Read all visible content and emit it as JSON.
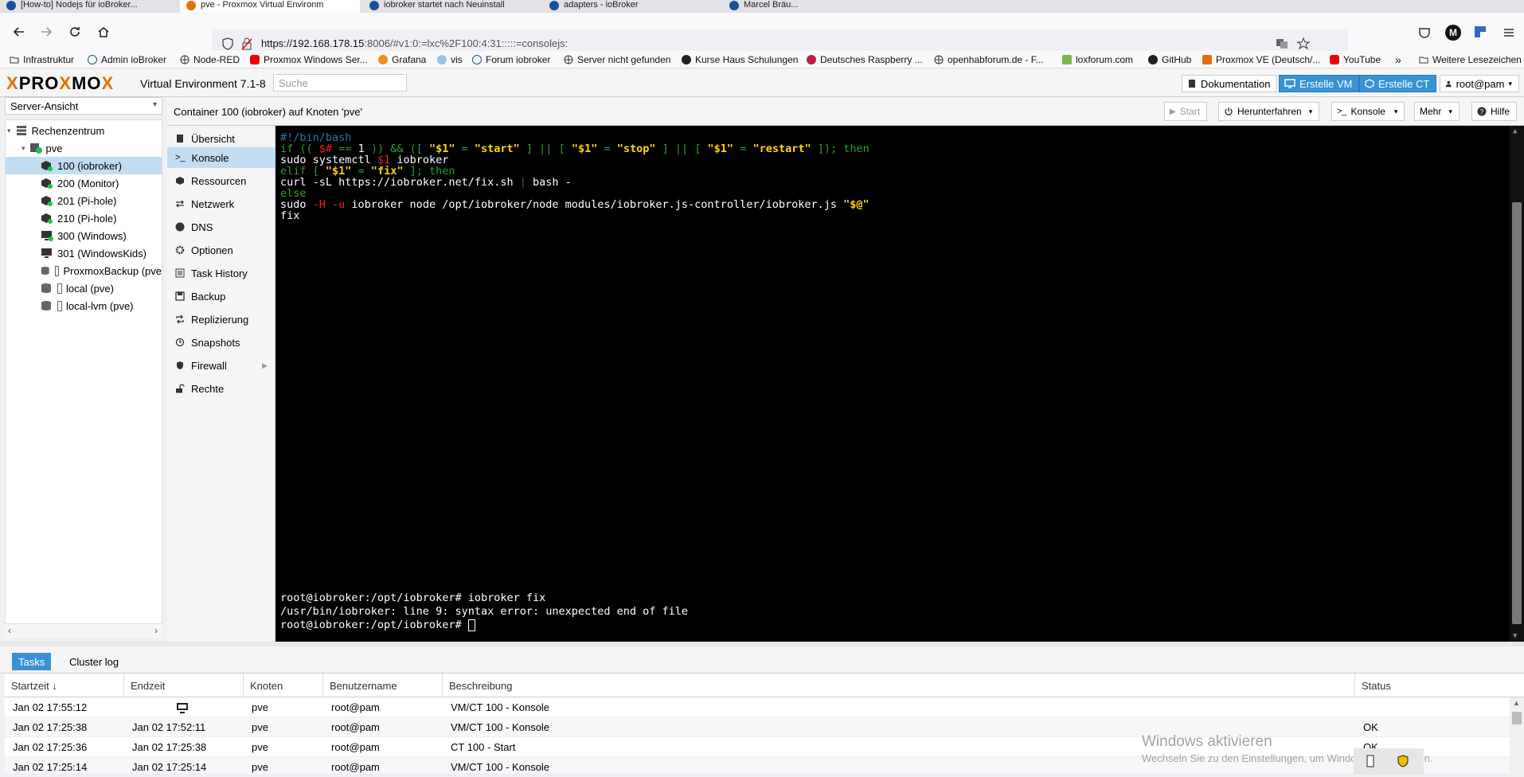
{
  "browser": {
    "tabs": [
      {
        "label": "[How-to] Nodejs für ioBroker...",
        "active": false
      },
      {
        "label": "pve - Proxmox Virtual Environm",
        "active": true
      },
      {
        "label": "iobroker startet nach Neuinstall",
        "active": false
      },
      {
        "label": "adapters - ioBroker",
        "active": false
      },
      {
        "label": "Marcel Bräu...",
        "active": false
      }
    ],
    "url_host": "https://192.168.178.15",
    "url_rest": ":8006/#v1:0:=lxc%2F100:4:31:::::=consolejs:",
    "bookmarks": [
      "Infrastruktur",
      "Admin ioBroker",
      "Node-RED",
      "Proxmox Windows Ser...",
      "Grafana",
      "vis",
      "Forum iobroker",
      "Server nicht gefunden",
      "Kurse Haus Schulungen",
      "Deutsches Raspberry ...",
      "openhabforum.de - F...",
      "loxforum.com",
      "GitHub",
      "Proxmox VE (Deutsch/...",
      "YouTube"
    ],
    "more_bookmarks": "Weitere Lesezeichen"
  },
  "header": {
    "logo_a": "PRO",
    "logo_b": "X",
    "logo_c": "MO",
    "logo_d": "X",
    "version": "Virtual Environment 7.1-8",
    "search_placeholder": "Suche",
    "doc_label": "Dokumentation",
    "create_vm_label": "Erstelle VM",
    "create_ct_label": "Erstelle CT",
    "user_label": "root@pam"
  },
  "sidebar": {
    "view_select": "Server-Ansicht",
    "tree": [
      {
        "label": "Rechenzentrum",
        "type": "datacenter"
      },
      {
        "label": "pve",
        "type": "node"
      },
      {
        "label": "100 (iobroker)",
        "type": "ct",
        "selected": true
      },
      {
        "label": "200 (Monitor)",
        "type": "ct"
      },
      {
        "label": "201 (Pi-hole)",
        "type": "ct"
      },
      {
        "label": "210 (Pi-hole)",
        "type": "ct"
      },
      {
        "label": "300 (Windows)",
        "type": "vm"
      },
      {
        "label": "301 (WindowsKids)",
        "type": "vm"
      },
      {
        "label": "ProxmoxBackup (pve",
        "type": "storage"
      },
      {
        "label": "local (pve)",
        "type": "storage"
      },
      {
        "label": "local-lvm (pve)",
        "type": "storage"
      }
    ]
  },
  "content": {
    "title": "Container 100 (iobroker) auf Knoten 'pve'",
    "start_label": "Start",
    "shutdown_label": "Herunterfahren",
    "console_label": "Konsole",
    "more_label": "Mehr",
    "help_label": "Hilfe",
    "menu": [
      {
        "label": "Übersicht",
        "icon": "book-icon"
      },
      {
        "label": "Konsole",
        "icon": "terminal-icon",
        "selected": true
      },
      {
        "label": "Ressourcen",
        "icon": "cube-icon"
      },
      {
        "label": "Netzwerk",
        "icon": "exchange-icon"
      },
      {
        "label": "DNS",
        "icon": "globe-icon"
      },
      {
        "label": "Optionen",
        "icon": "gear-icon"
      },
      {
        "label": "Task History",
        "icon": "list-icon"
      },
      {
        "label": "Backup",
        "icon": "floppy-icon"
      },
      {
        "label": "Replizierung",
        "icon": "retweet-icon"
      },
      {
        "label": "Snapshots",
        "icon": "history-icon"
      },
      {
        "label": "Firewall",
        "icon": "shield-icon"
      },
      {
        "label": "Rechte",
        "icon": "unlock-icon"
      }
    ]
  },
  "terminal": {
    "script": [
      [
        {
          "t": "#!/bin/bash",
          "c": "cmt"
        }
      ],
      [
        {
          "t": "if (( ",
          "c": "kw"
        },
        {
          "t": "$#",
          "c": "var"
        },
        {
          "t": " == ",
          "c": "kw"
        },
        {
          "t": "1",
          "c": ""
        },
        {
          "t": " )) && ([ ",
          "c": "kw"
        },
        {
          "t": "\"$1\"",
          "c": "str"
        },
        {
          "t": " = ",
          "c": "kw"
        },
        {
          "t": "\"start\"",
          "c": "str"
        },
        {
          "t": " ] || [ ",
          "c": "kw"
        },
        {
          "t": "\"$1\"",
          "c": "str"
        },
        {
          "t": " = ",
          "c": "kw"
        },
        {
          "t": "\"stop\"",
          "c": "str"
        },
        {
          "t": " ] || [ ",
          "c": "kw"
        },
        {
          "t": "\"$1\"",
          "c": "str"
        },
        {
          "t": " = ",
          "c": "kw"
        },
        {
          "t": "\"restart\"",
          "c": "str"
        },
        {
          "t": " ]); then",
          "c": "kw"
        }
      ],
      [
        {
          "t": "sudo systemctl ",
          "c": ""
        },
        {
          "t": "$1",
          "c": "var"
        },
        {
          "t": " iobroker",
          "c": ""
        }
      ],
      [
        {
          "t": "elif [ ",
          "c": "kw"
        },
        {
          "t": "\"$1\"",
          "c": "str"
        },
        {
          "t": " = ",
          "c": "kw"
        },
        {
          "t": "\"fix\"",
          "c": "str"
        },
        {
          "t": " ]; then",
          "c": "kw"
        }
      ],
      [
        {
          "t": "curl ",
          "c": ""
        },
        {
          "t": "-sL",
          "c": ""
        },
        {
          "t": " https://iobroker.net/fix.sh ",
          "c": ""
        },
        {
          "t": "|",
          "c": "op"
        },
        {
          "t": " bash -",
          "c": ""
        }
      ],
      [
        {
          "t": "else",
          "c": "kw"
        }
      ],
      [
        {
          "t": "sudo ",
          "c": ""
        },
        {
          "t": "-H -u",
          "c": "var"
        },
        {
          "t": " iobroker node /opt/iobroker/node modules/iobroker.js-controller/iobroker.js ",
          "c": ""
        },
        {
          "t": "\"$@\"",
          "c": "str"
        }
      ],
      [
        {
          "t": "fix",
          "c": ""
        }
      ]
    ],
    "output": [
      "root@iobroker:/opt/iobroker# iobroker fix",
      "/usr/bin/iobroker: line 9: syntax error: unexpected end of file",
      "root@iobroker:/opt/iobroker# "
    ]
  },
  "tasks": {
    "tab_tasks": "Tasks",
    "tab_cluster": "Cluster log",
    "columns": [
      "Startzeit ↓",
      "Endzeit",
      "Knoten",
      "Benutzername",
      "Beschreibung",
      "Status"
    ],
    "rows": [
      {
        "start": "Jan 02 17:55:12",
        "end": "",
        "end_icon": "monitor-icon",
        "node": "pve",
        "user": "root@pam",
        "desc": "VM/CT 100 - Konsole",
        "status": ""
      },
      {
        "start": "Jan 02 17:25:38",
        "end": "Jan 02 17:52:11",
        "node": "pve",
        "user": "root@pam",
        "desc": "VM/CT 100 - Konsole",
        "status": "OK"
      },
      {
        "start": "Jan 02 17:25:36",
        "end": "Jan 02 17:25:38",
        "node": "pve",
        "user": "root@pam",
        "desc": "CT 100 - Start",
        "status": "OK"
      },
      {
        "start": "Jan 02 17:25:14",
        "end": "Jan 02 17:25:14",
        "node": "pve",
        "user": "root@pam",
        "desc": "VM/CT 100 - Konsole",
        "status": "OK"
      }
    ]
  },
  "watermark": {
    "line1": "Windows aktivieren",
    "line2": "Wechseln Sie zu den Einstellungen, um Windows zu aktivieren."
  }
}
